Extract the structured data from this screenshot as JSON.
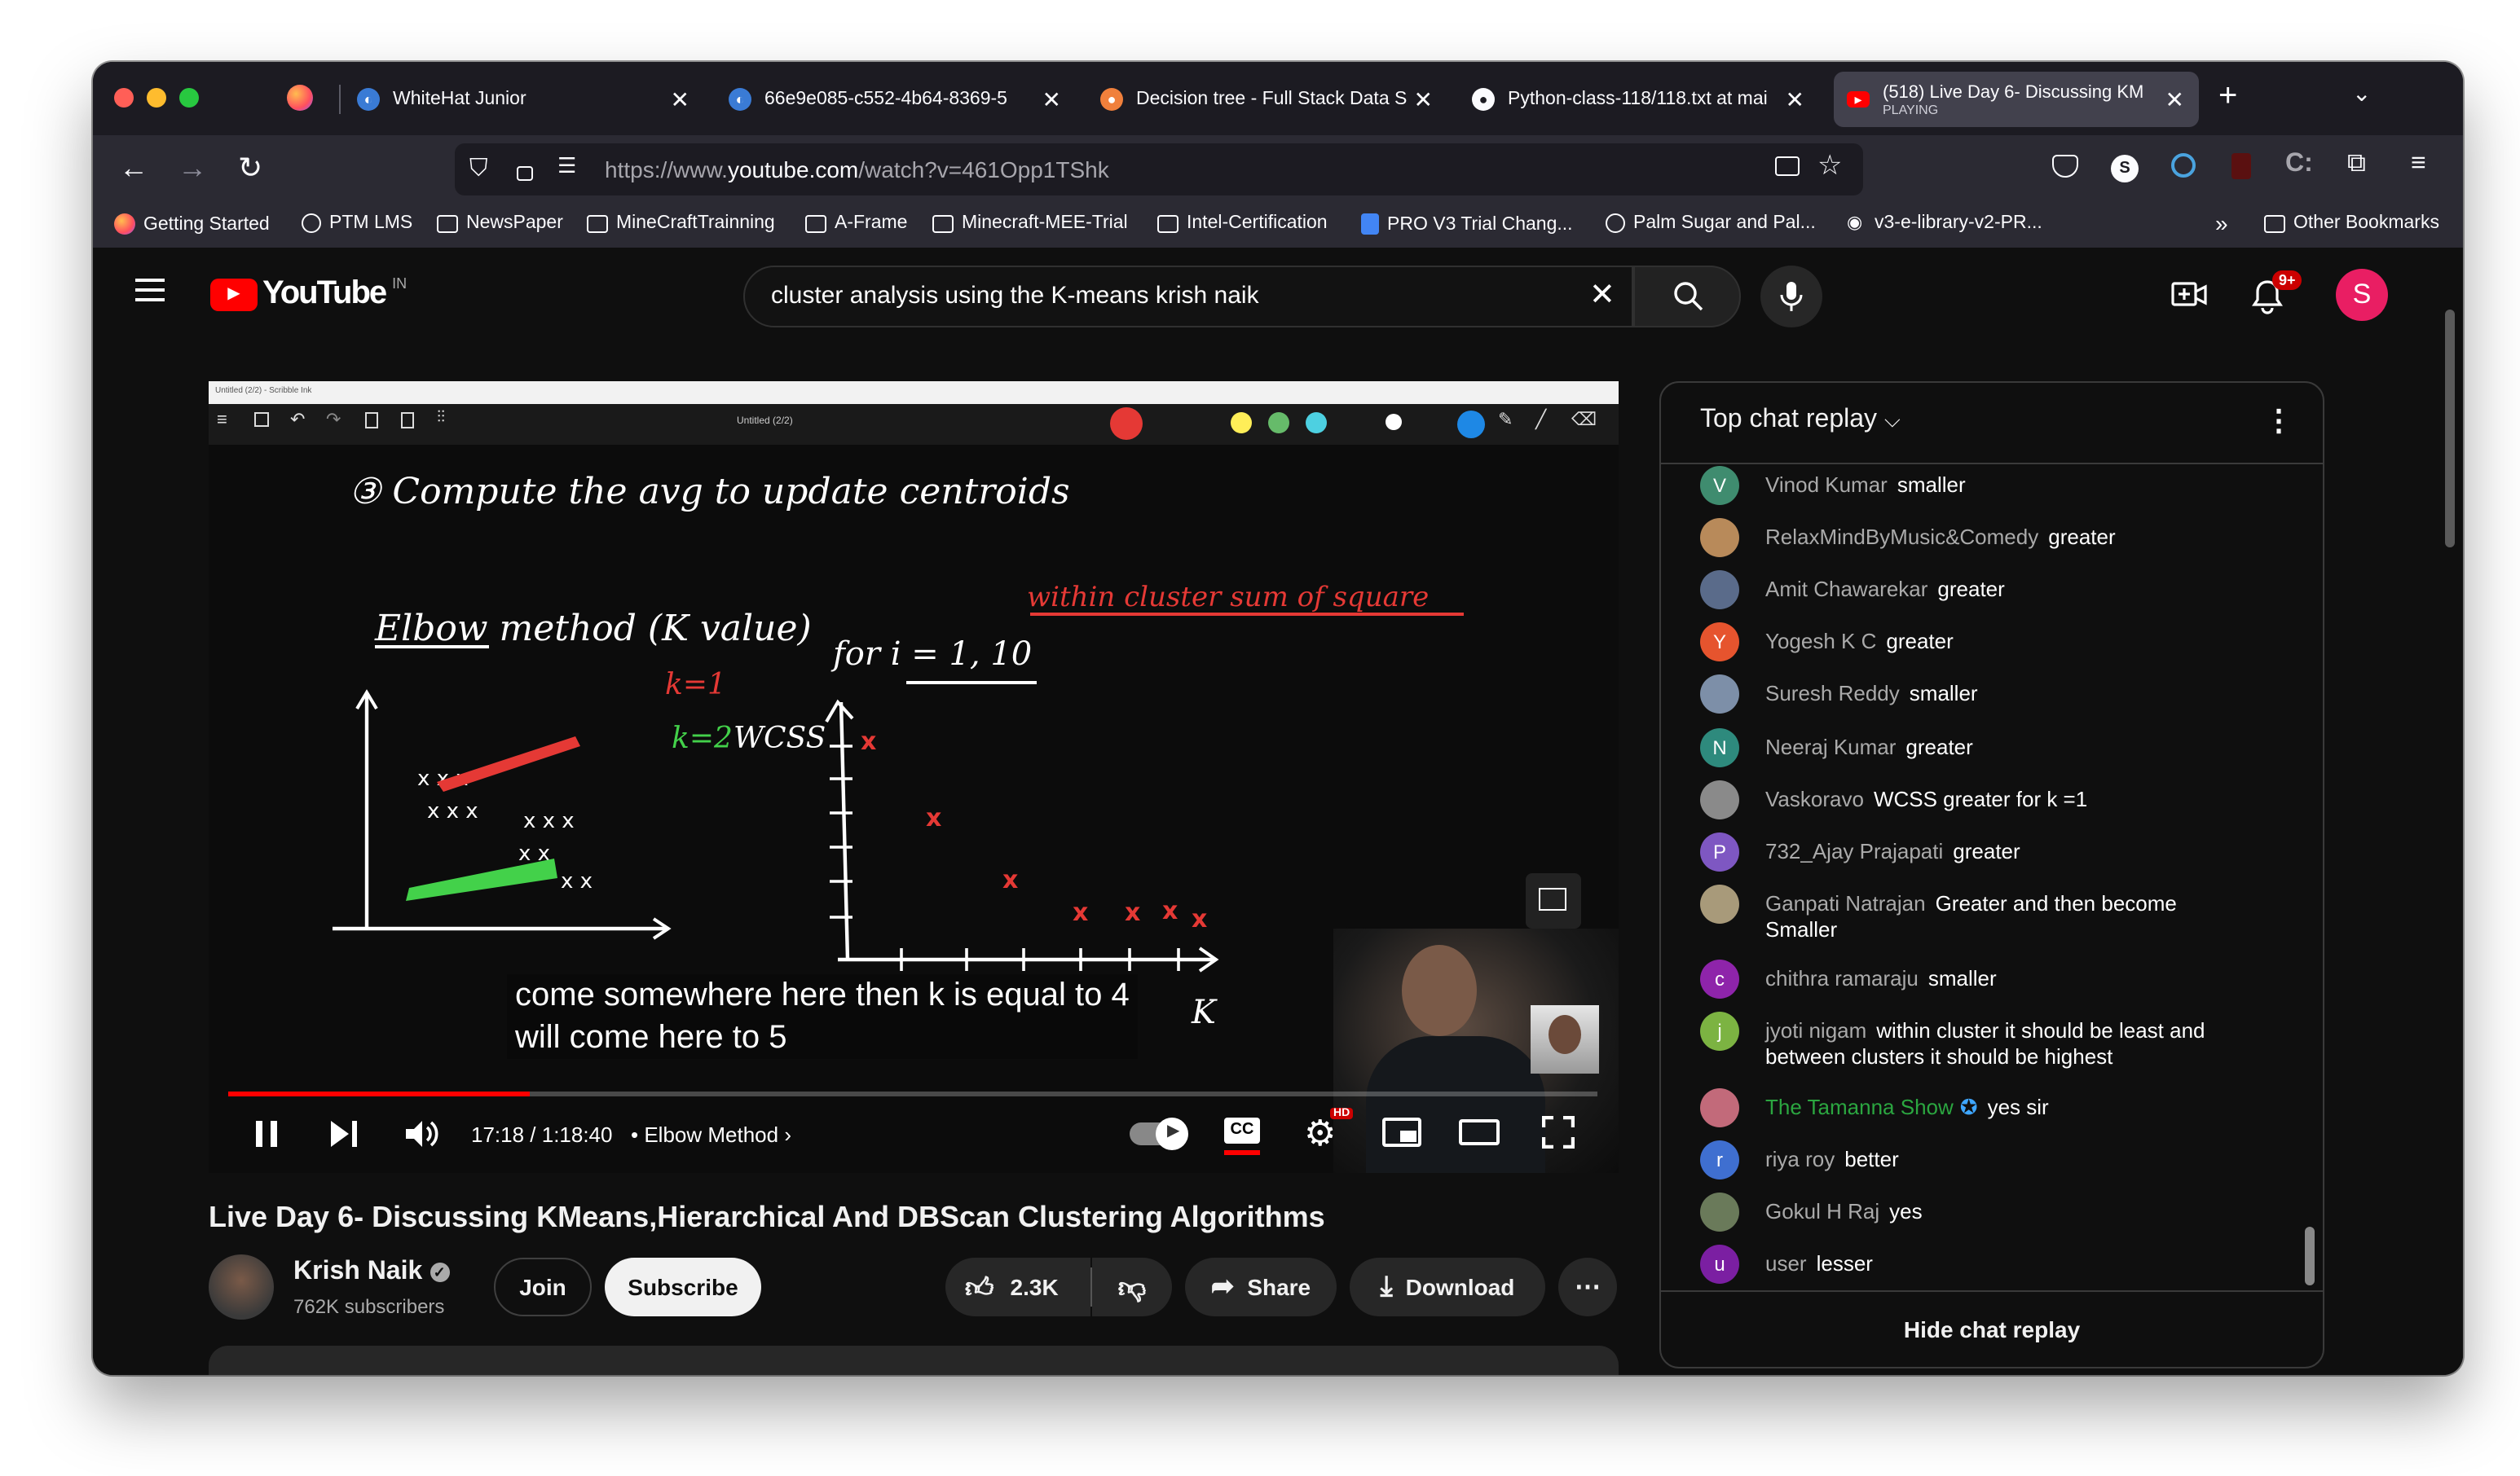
{
  "browser": {
    "tabs": [
      {
        "title": "WhiteHat Junior",
        "subtitle": ""
      },
      {
        "title": "66e9e085-c552-4b64-8369-5",
        "subtitle": ""
      },
      {
        "title": "Decision tree - Full Stack Data S",
        "subtitle": ""
      },
      {
        "title": "Python-class-118/118.txt at mai",
        "subtitle": ""
      },
      {
        "title": "(518) Live Day 6- Discussing KM",
        "subtitle": "PLAYING"
      }
    ],
    "url": {
      "prefix": "https://www.",
      "domain": "youtube.com",
      "path": "/watch?v=461Opp1TShk"
    },
    "profile_initial": "S",
    "bookmarks": [
      "Getting Started",
      "PTM LMS",
      "NewsPaper",
      "MineCraftTrainning",
      "A-Frame",
      "Minecraft-MEE-Trial",
      "Intel-Certification",
      "PRO V3 Trial Chang...",
      "Palm Sugar and Pal...",
      "v3-e-library-v2-PR..."
    ],
    "other_bookmarks": "Other Bookmarks"
  },
  "youtube": {
    "logo_text": "YouTube",
    "region": "IN",
    "search_query": "cluster analysis using the K-means krish naik",
    "notif_count": "9+",
    "avatar_initial": "S"
  },
  "video": {
    "screen_title": "Untitled (2/2) - Scribble Ink",
    "toolbar_doc_title": "Untitled (2/2)",
    "handwriting": {
      "step": "③ Compute the avg to update centroids",
      "elbow": "Elbow method (K value)",
      "loop": "for i = 1, 10",
      "wcss_note": "within cluster sum of square",
      "k1": "k=1",
      "k2": "k=2",
      "k2_wcss": "WCSS",
      "axis_k": "K"
    },
    "caption_lines": [
      "come somewhere here then k is equal to 4",
      "will come here to 5"
    ],
    "time": "17:18 / 1:18:40",
    "chapter": "Elbow Method",
    "progress_fraction": 0.22,
    "hd_badge": "HD"
  },
  "meta": {
    "title": "Live Day 6- Discussing KMeans,Hierarchical And DBScan Clustering Algorithms",
    "channel": "Krish Naik",
    "subscribers": "762K subscribers",
    "join": "Join",
    "subscribe": "Subscribe",
    "likes": "2.3K",
    "share": "Share",
    "download": "Download"
  },
  "chat": {
    "header": "Top chat replay",
    "footer": "Hide chat replay",
    "messages": [
      {
        "author": "Vinod Kumar",
        "text": "smaller",
        "initial": "V",
        "color": "#3f8c6f"
      },
      {
        "author": "RelaxMindByMusic&Comedy",
        "text": "greater",
        "initial": "",
        "color": "#b88a5a"
      },
      {
        "author": "Amit Chawarekar",
        "text": "greater",
        "initial": "",
        "color": "#5a6b8a"
      },
      {
        "author": "Yogesh K C",
        "text": "greater",
        "initial": "Y",
        "color": "#e6542e"
      },
      {
        "author": "Suresh Reddy",
        "text": "smaller",
        "initial": "",
        "color": "#7d8fa8"
      },
      {
        "author": "Neeraj Kumar",
        "text": "greater",
        "initial": "N",
        "color": "#2e8a7d"
      },
      {
        "author": "Vaskoravo",
        "text": "WCSS greater for k =1",
        "initial": "",
        "color": "#8a8a8a"
      },
      {
        "author": "732_Ajay Prajapati",
        "text": "greater",
        "initial": "P",
        "color": "#7e57c2"
      },
      {
        "author": "Ganpati Natrajan",
        "text": "Greater and then become Smaller",
        "initial": "",
        "color": "#a89a7a"
      },
      {
        "author": "chithra ramaraju",
        "text": "smaller",
        "initial": "c",
        "color": "#8e24aa"
      },
      {
        "author": "jyoti nigam",
        "text": "within cluster it should be least and between clusters it should be highest",
        "initial": "j",
        "color": "#7cb342"
      },
      {
        "author": "The Tamanna Show",
        "text": "yes sir",
        "initial": "",
        "color": "#c26a7a",
        "member": true
      },
      {
        "author": "riya roy",
        "text": "better",
        "initial": "r",
        "color": "#3f6fd0"
      },
      {
        "author": "Gokul H Raj",
        "text": "yes",
        "initial": "",
        "color": "#6a7a5a"
      },
      {
        "author": "user",
        "text": "lesser",
        "initial": "u",
        "color": "#7b1fa2"
      }
    ]
  }
}
